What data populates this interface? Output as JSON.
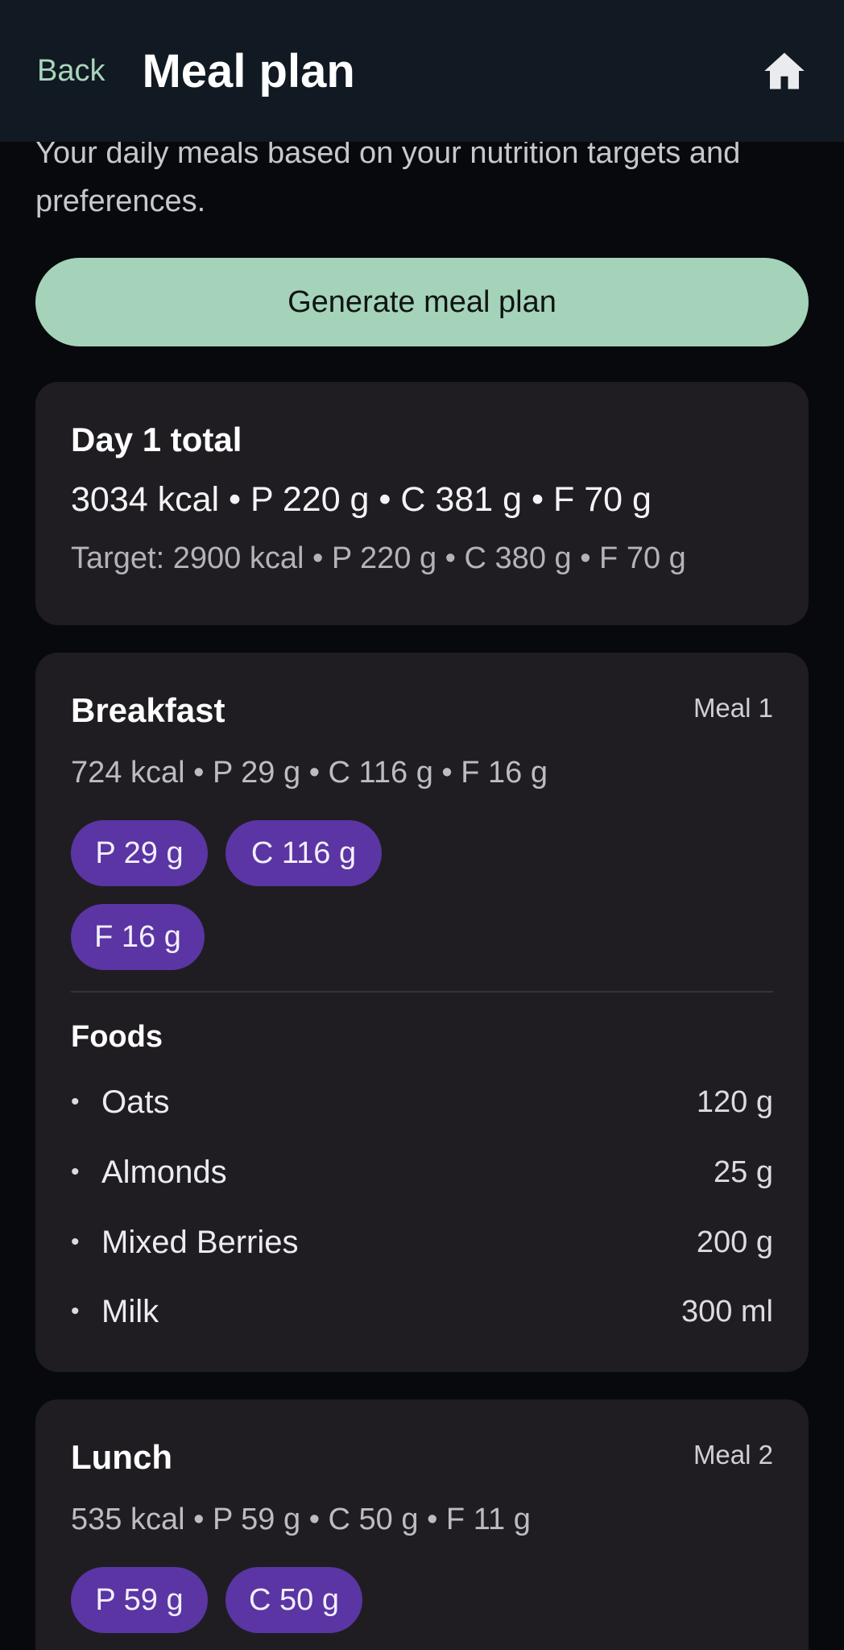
{
  "header": {
    "back_label": "Back",
    "title": "Meal plan"
  },
  "intro": {
    "text": "Your daily meals based on your nutrition targets and preferences."
  },
  "generate_button": {
    "label": "Generate meal plan"
  },
  "day_total": {
    "title": "Day 1 total",
    "summary": "3034 kcal • P 220 g • C 381 g • F 70 g",
    "target": "Target: 2900 kcal • P 220 g • C 380 g • F 70 g"
  },
  "meals": [
    {
      "title": "Breakfast",
      "tag": "Meal 1",
      "summary": "724 kcal • P 29 g • C 116 g • F 16 g",
      "chips": [
        "P 29 g",
        "C 116 g",
        "F 16 g"
      ],
      "foods_label": "Foods",
      "foods": [
        {
          "name": "Oats",
          "qty": "120 g"
        },
        {
          "name": "Almonds",
          "qty": "25 g"
        },
        {
          "name": "Mixed Berries",
          "qty": "200 g"
        },
        {
          "name": "Milk",
          "qty": "300 ml"
        }
      ]
    },
    {
      "title": "Lunch",
      "tag": "Meal 2",
      "summary": "535 kcal • P 59 g • C 50 g • F 11 g",
      "chips": [
        "P 59 g",
        "C 50 g"
      ]
    }
  ],
  "icons": {
    "home": "home-icon",
    "bullet": "•"
  },
  "colors": {
    "accent_green": "#a4d3ba",
    "chip_purple": "#5a35a3",
    "card_bg": "#1f1d22",
    "header_bg": "#111922"
  }
}
